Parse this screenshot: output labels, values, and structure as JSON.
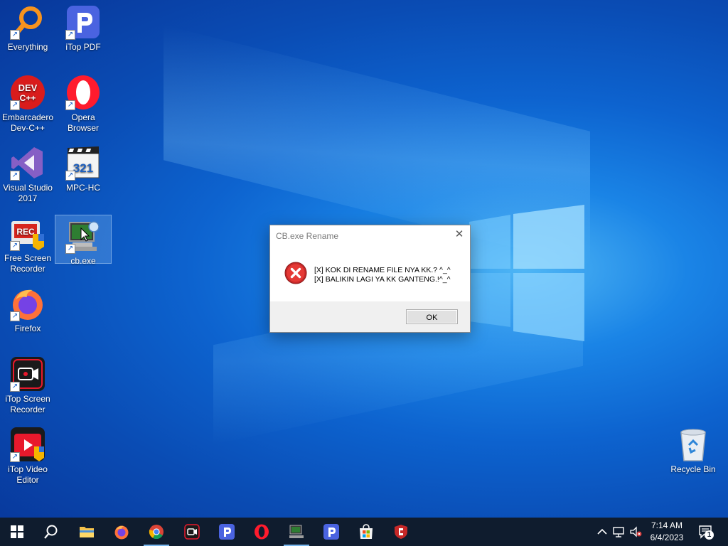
{
  "desktop_icons": {
    "everything": "Everything",
    "itop_pdf": "iTop PDF",
    "devcpp_line1": "Embarcadero",
    "devcpp_line2": "Dev-C++",
    "opera_line1": "Opera",
    "opera_line2": "Browser",
    "vs_line1": "Visual Studio",
    "vs_line2": "2017",
    "mpc": "MPC-HC",
    "fsr_line1": "Free Screen",
    "fsr_line2": "Recorder",
    "cbexe": "cb.exe",
    "firefox": "Firefox",
    "itop_sr_line1": "iTop Screen",
    "itop_sr_line2": "Recorder",
    "itop_ve_line1": "iTop Video",
    "itop_ve_line2": "Editor",
    "recycle_bin": "Recycle Bin",
    "devcpp_badge_line1": "DEV",
    "devcpp_badge_line2": "C++",
    "mpc_badge": "321",
    "rec_badge": "REC"
  },
  "dialog": {
    "title": "CB.exe Rename",
    "close_glyph": "✕",
    "message_line1": "[X] KOK DI RENAME FILE NYA KK.? ^_^",
    "message_line2": "[X] BALIKIN LAGI YA KK GANTENG.!^_^",
    "ok_label": "OK"
  },
  "taskbar": {
    "time": "7:14 AM",
    "date": "6/4/2023",
    "notification_count": "1",
    "pinned": [
      "start",
      "search",
      "file-explorer",
      "firefox",
      "chrome",
      "itop-screen-recorder",
      "itop-pdf",
      "opera",
      "cb-exe",
      "itop-pdf-2",
      "microsoft-store",
      "cb-shield"
    ]
  },
  "colors": {
    "taskbar_bg": "#0f1c2e",
    "desktop_accent": "#0d63cf",
    "error_red": "#d32f2f"
  }
}
